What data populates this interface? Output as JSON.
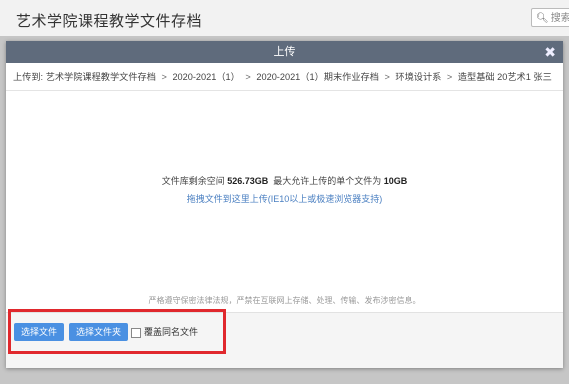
{
  "background": {
    "title": "艺术学院课程教学文件存档",
    "search_placeholder": "搜索文"
  },
  "modal": {
    "title": "上传",
    "close_glyph": "✖",
    "breadcrumb_label": "上传到:",
    "breadcrumb": [
      "艺术学院课程教学文件存档",
      "2020-2021（1）",
      "2020-2021（1）期末作业存档",
      "环境设计系",
      "造型基础 20艺术1 张三"
    ],
    "breadcrumb_sep": ">",
    "quota_prefix": "文件库剩余空间",
    "quota_space": "526.73GB",
    "quota_mid": "最大允许上传的单个文件为",
    "quota_max": "10GB",
    "drag_hint": "拖拽文件到这里上传(IE10以上或极速浏览器支持)",
    "legal_notice": "严格遵守保密法律法规，严禁在互联网上存储、处理、传输、发布涉密信息。"
  },
  "footer": {
    "choose_file": "选择文件",
    "choose_folder": "选择文件夹",
    "overwrite_label": "覆盖同名文件"
  },
  "colors": {
    "header": "#5f6b7c",
    "button": "#4a90e2",
    "highlight": "#e0282d",
    "link": "#4a7fc1"
  }
}
